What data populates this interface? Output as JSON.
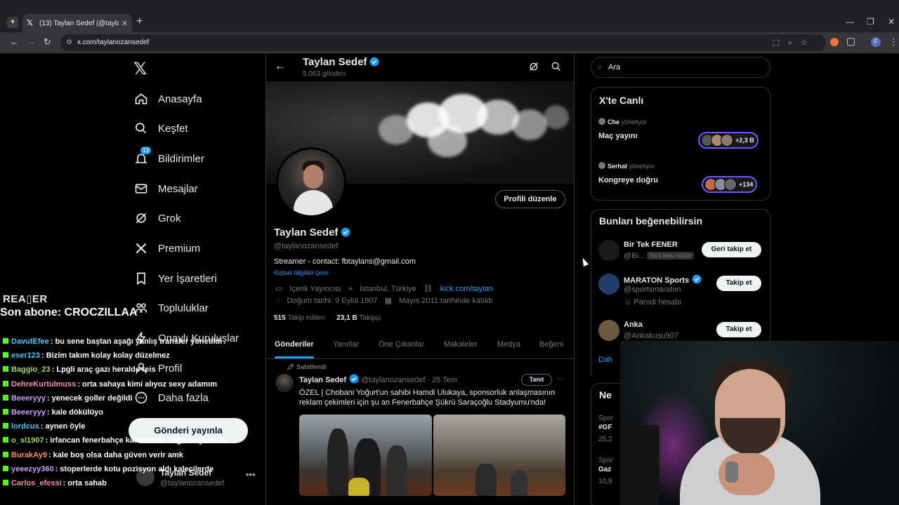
{
  "browser": {
    "tab_title": "(13) Taylan Sedef (@taylanoza",
    "url": "x.com/taylanozansedef",
    "profile_initial": "F"
  },
  "nav": {
    "items": [
      {
        "label": "Anasayfa",
        "icon": "home-icon"
      },
      {
        "label": "Keşfet",
        "icon": "search-icon"
      },
      {
        "label": "Bildirimler",
        "icon": "bell-icon",
        "badge": "13"
      },
      {
        "label": "Mesajlar",
        "icon": "mail-icon"
      },
      {
        "label": "Grok",
        "icon": "grok-icon"
      },
      {
        "label": "Premium",
        "icon": "x-logo-icon"
      },
      {
        "label": "Yer İşaretleri",
        "icon": "bookmark-icon"
      },
      {
        "label": "Topluluklar",
        "icon": "communities-icon"
      },
      {
        "label": "Onaylı Kuruluşlar",
        "icon": "lightning-icon"
      },
      {
        "label": "Profil",
        "icon": "person-icon"
      },
      {
        "label": "Daha fazla",
        "icon": "more-icon"
      }
    ],
    "post_button": "Gönderi yayınla",
    "account_name": "Taylan Sedef",
    "account_handle": "@taylanozansedef"
  },
  "profile": {
    "name": "Taylan Sedef",
    "post_count": "5.063 gönderi",
    "handle": "@taylanozansedef",
    "edit_button": "Profili düzenle",
    "bio": "Streamer - contact: fbtaylans@gmail.com",
    "translate": "Kişisel bilgileri çevir",
    "category": "İçerik Yayıncısı",
    "location": "İstanbul, Türkiye",
    "link": "kick.com/taylan",
    "birthday": "Doğum tarihi: 9 Eylül 1907",
    "joined": "Mayıs 2011 tarihinde katıldı",
    "following_count": "515",
    "following_label": "Takip edilen",
    "followers_count": "23,1 B",
    "followers_label": "Takipçi"
  },
  "tabs": [
    "Gönderiler",
    "Yanıtlar",
    "Öne Çıkanlar",
    "Makaleler",
    "Medya",
    "Beğeni"
  ],
  "tweet": {
    "pinned_label": "Sabitlendi",
    "author": "Taylan Sedef",
    "handle_date": "@taylanozansedef · 25 Tem",
    "promote_button": "Tanıt",
    "text": "ÖZEL | Chobani Yoğurt'un sahibi Hamdi Ulukaya, sponsorluk anlaşmasının reklam çekimleri için şu an Fenerbahçe Şükrü Saraçoğlu Stadyumu'nda!"
  },
  "search": {
    "placeholder": "Ara"
  },
  "live": {
    "title": "X'te Canlı",
    "items": [
      {
        "host": "Che",
        "role": "yönetiyor",
        "title": "Maç yayını",
        "count": "+2,3 B"
      },
      {
        "host": "Serhat",
        "role": "yönetiyor",
        "title": "Kongreye doğru",
        "count": "+134"
      }
    ]
  },
  "suggestions": {
    "title": "Bunları beğenebilirsin",
    "items": [
      {
        "name": "Bir Tek FENER",
        "handle": "@Bi...",
        "follows_you": "Seni takip ediyor",
        "button": "Geri takip et"
      },
      {
        "name": "MARATON Sports",
        "handle": "@sportsmaraton",
        "sub": "Parodi hesabı",
        "button": "Takip et"
      },
      {
        "name": "Anka",
        "handle": "@Ankakusu907",
        "button": "Takip et"
      }
    ],
    "more_link": "Dah"
  },
  "news": {
    "title": "Ne",
    "lines": [
      "Spor",
      "#GF",
      "25,2",
      "Spor",
      "Gaz",
      "10,9"
    ]
  },
  "stream": {
    "reader_logo": "REA▯ER",
    "sub_banner": "Son abone: CROCZILLAA",
    "chat": [
      {
        "user": "DavutEfee",
        "msg": ": bu sene baştan aşağı yanlış transfer yönetildi",
        "color": "#4fc3f7"
      },
      {
        "user": "eser123",
        "msg": ": Bizim takım kolay kolay düzelmez",
        "color": "#4fc3f7"
      },
      {
        "user": "Baggio_23",
        "msg": ": Lpgli araç gazı heralde reis",
        "color": "#a5d66a"
      },
      {
        "user": "DehreKurtulmuss",
        "msg": ": orta sahaya kimi alıyoz sexy adamım",
        "color": "#f08fb0"
      },
      {
        "user": "Beeeryyy",
        "msg": ": yenecek goller değildi",
        "color": "#c89cff"
      },
      {
        "user": "Beeeryyy",
        "msg": ": kale dökülüyo",
        "color": "#c89cff"
      },
      {
        "user": "lordcus",
        "msg": ": aynen öyle",
        "color": "#4fc3f7"
      },
      {
        "user": "o_sl1907",
        "msg": ": irfancan fenerbahçe kalitesinde değil ne yazık ki",
        "color": "#a5d66a"
      },
      {
        "user": "BurakAy9",
        "msg": ": kale boş olsa daha güven verir amk",
        "color": "#ff8a65"
      },
      {
        "user": "yeeezyy360",
        "msg": ": stoperlerde kotu pozisyon aldı kalecilerde",
        "color": "#c89cff"
      },
      {
        "user": "Carlos_efessi",
        "msg": ": orta sahab",
        "color": "#f08fb0"
      }
    ]
  }
}
